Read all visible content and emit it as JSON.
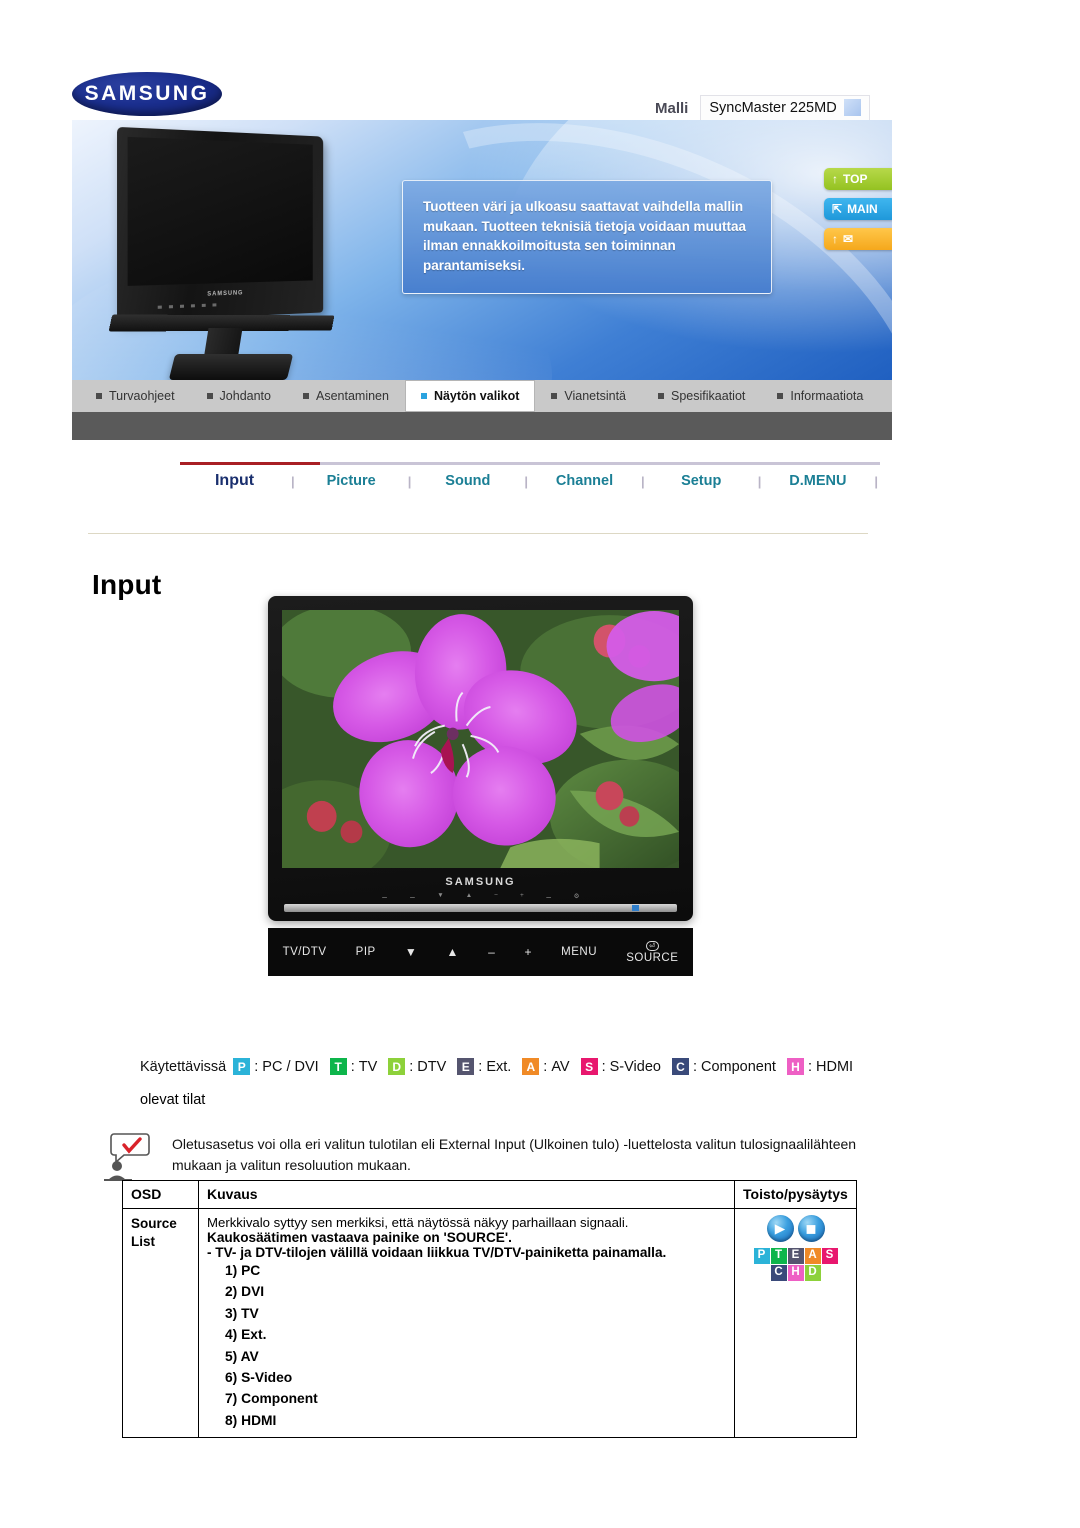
{
  "brand": {
    "logo_text": "SAMSUNG"
  },
  "header": {
    "model_label": "Malli",
    "model_value": "SyncMaster 225MD"
  },
  "banner": {
    "disclaimer": "Tuotteen väri ja ulkoasu saattavat vaihdella mallin mukaan. Tuotteen teknisiä tietoja voidaan muuttaa ilman ennakkoilmoitusta sen toiminnan parantamiseksi.",
    "side_buttons": [
      {
        "label": "TOP",
        "icon": "arrow-up-icon",
        "color": "#94c221"
      },
      {
        "label": "MAIN",
        "icon": "arrow-turn-icon",
        "color": "#1f98da"
      },
      {
        "label": "",
        "icon": "mail-icon",
        "color": "#f5a81c"
      }
    ]
  },
  "main_tabs": [
    {
      "label": "Turvaohjeet",
      "active": false
    },
    {
      "label": "Johdanto",
      "active": false
    },
    {
      "label": "Asentaminen",
      "active": false
    },
    {
      "label": "Näytön valikot",
      "active": true
    },
    {
      "label": "Vianetsintä",
      "active": false
    },
    {
      "label": "Spesifikaatiot",
      "active": false
    },
    {
      "label": "Informaatiota",
      "active": false
    }
  ],
  "sub_menu": {
    "items": [
      {
        "label": "Input",
        "active": true
      },
      {
        "label": "Picture",
        "active": false
      },
      {
        "label": "Sound",
        "active": false
      },
      {
        "label": "Channel",
        "active": false
      },
      {
        "label": "Setup",
        "active": false
      },
      {
        "label": "D.MENU",
        "active": false
      }
    ],
    "accent_color": "#a81f24"
  },
  "page_title": "Input",
  "monitor": {
    "brand": "SAMSUNG",
    "control_keys": [
      {
        "label": "TV/DTV"
      },
      {
        "label": "PIP"
      },
      {
        "label": "▼"
      },
      {
        "label": "▲"
      },
      {
        "label": "–"
      },
      {
        "label": "+"
      },
      {
        "label": "MENU"
      },
      {
        "label": "SOURCE"
      }
    ]
  },
  "legend": {
    "lead": "Käytettävissä",
    "entries": [
      {
        "code": "P",
        "text": "PC / DVI",
        "color": "#2bb3d8"
      },
      {
        "code": "T",
        "text": "TV",
        "color": "#0db54b"
      },
      {
        "code": "D",
        "text": "DTV",
        "color": "#8dd13a"
      },
      {
        "code": "E",
        "text": "Ext.",
        "color": "#55556f"
      },
      {
        "code": "A",
        "text": "AV",
        "color": "#f08a26"
      },
      {
        "code": "S",
        "text": "S-Video",
        "color": "#e8176e"
      },
      {
        "code": "C",
        "text": "Component",
        "color": "#3a4a7a"
      },
      {
        "code": "H",
        "text": "HDMI",
        "color": "#ee5fc4"
      }
    ],
    "second_line": "olevat tilat"
  },
  "note": {
    "icon": "note-person-check-icon",
    "text": "Oletusasetus voi olla eri valitun tulotilan eli External Input (Ulkoinen tulo) -luettelosta valitun tulosignaalilähteen mukaan ja valitun resoluution mukaan."
  },
  "table": {
    "headers": [
      "OSD",
      "Kuvaus",
      "Toisto/pysäytys"
    ],
    "row": {
      "osd": "Source List",
      "desc_plain": "Merkkivalo syttyy sen merkiksi, että näytössä näkyy parhaillaan signaali.",
      "desc_bold_1": "Kaukosäätimen vastaava painike on 'SOURCE'.",
      "desc_bold_2": "- TV- ja DTV-tilojen välillä voidaan liikkua TV/DTV-painiketta painamalla.",
      "items": [
        "1) PC",
        "2) DVI",
        "3) TV",
        "4) Ext.",
        "5) AV",
        "6) S-Video",
        "7) Component",
        "8) HDMI"
      ],
      "control_badges_row1": [
        {
          "code": "P",
          "color": "#2bb3d8"
        },
        {
          "code": "T",
          "color": "#0db54b"
        },
        {
          "code": "E",
          "color": "#55556f"
        },
        {
          "code": "A",
          "color": "#f08a26"
        },
        {
          "code": "S",
          "color": "#e8176e"
        }
      ],
      "control_badges_row2": [
        {
          "code": "C",
          "color": "#3a4a7a"
        },
        {
          "code": "H",
          "color": "#ee5fc4"
        },
        {
          "code": "D",
          "color": "#8dd13a"
        }
      ]
    }
  }
}
